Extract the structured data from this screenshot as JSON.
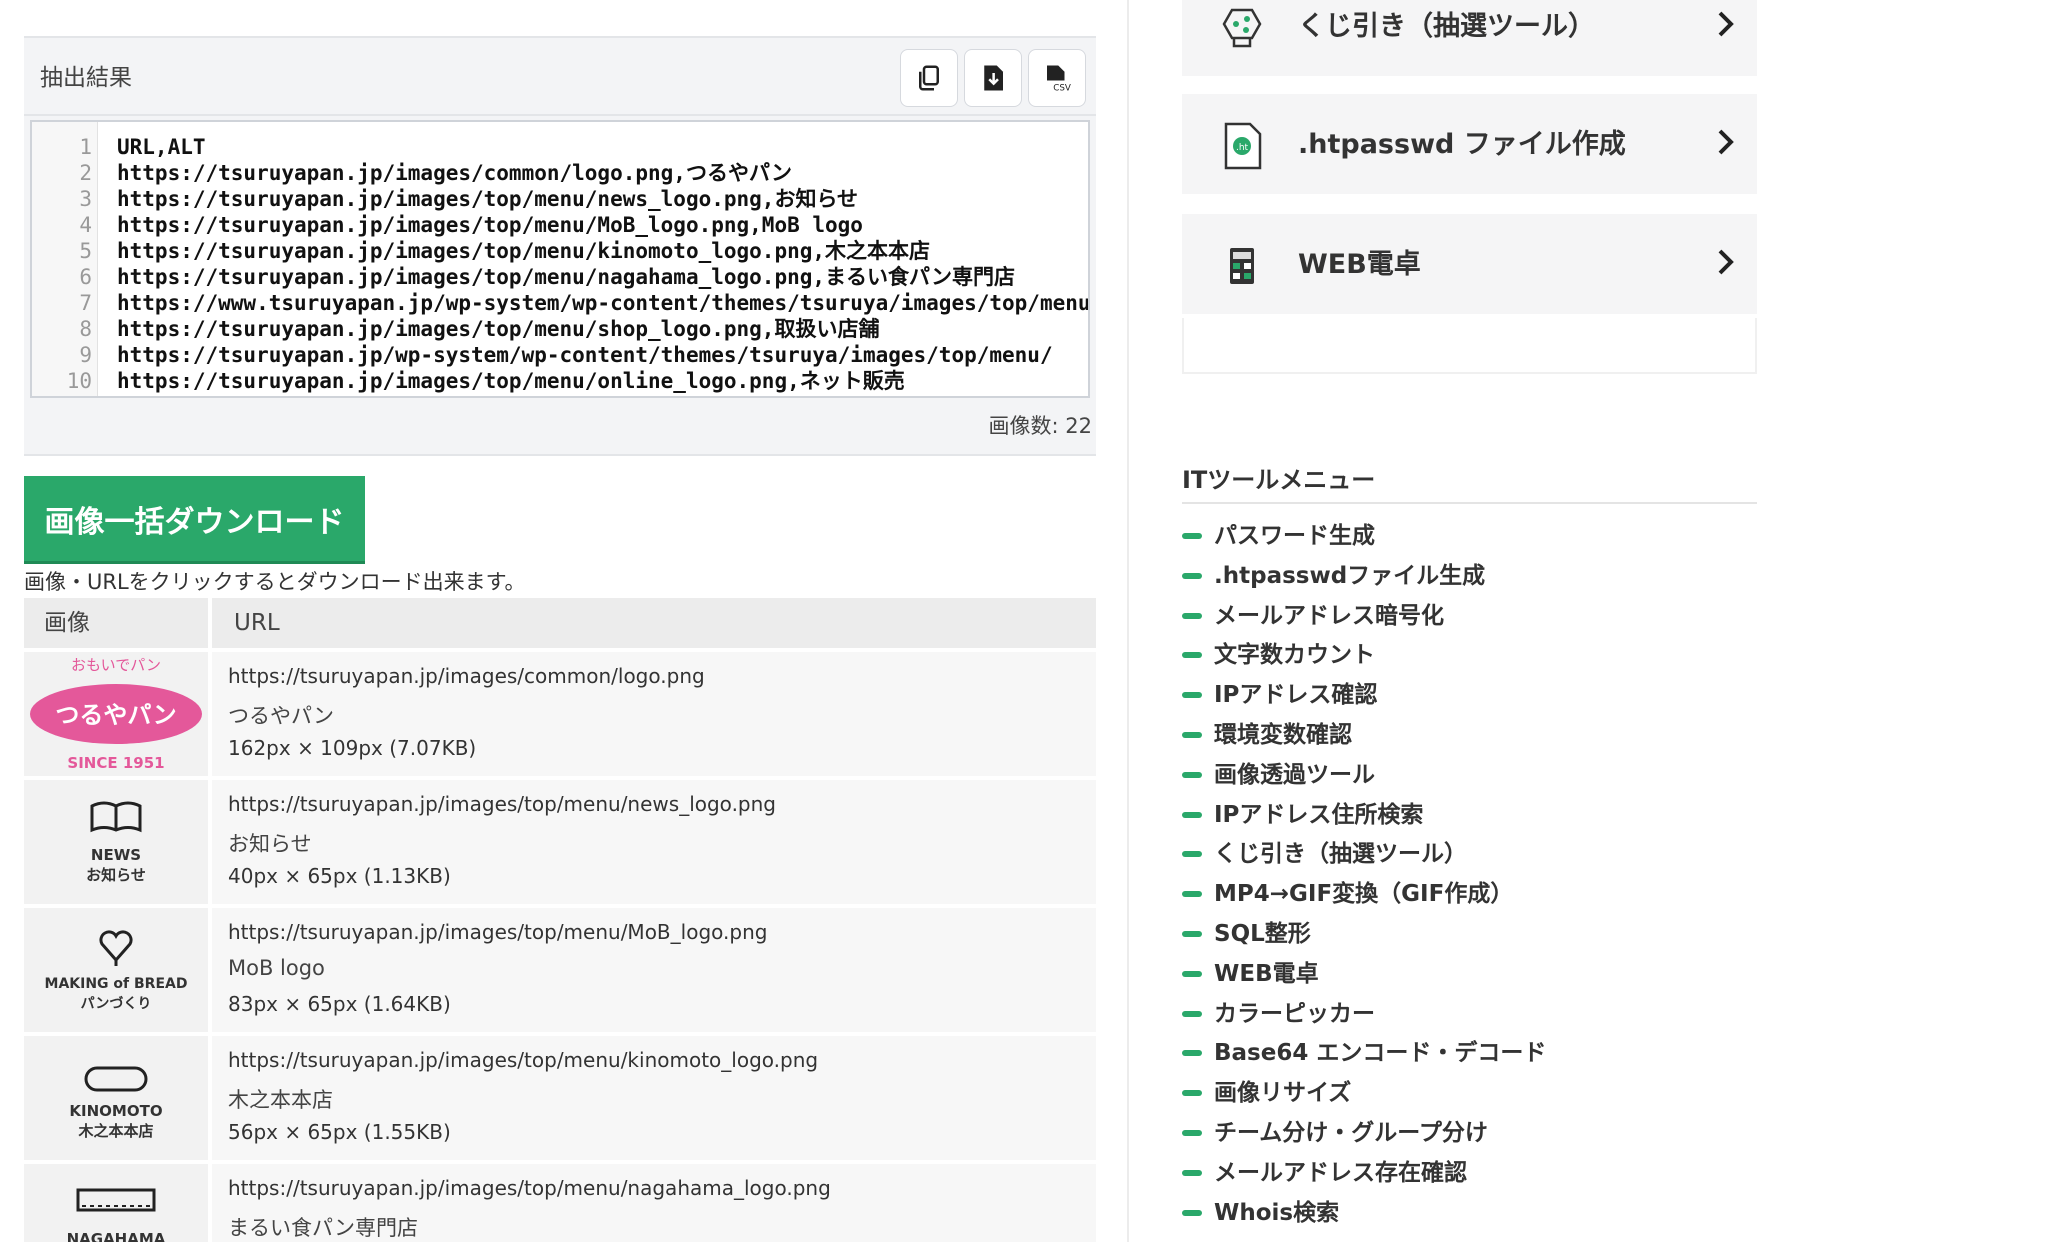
{
  "result": {
    "title": "抽出結果",
    "buttons": [
      "copy-icon",
      "download-icon",
      "csv-icon"
    ],
    "lines": [
      "URL,ALT",
      "https://tsuruyapan.jp/images/common/logo.png,つるやパン",
      "https://tsuruyapan.jp/images/top/menu/news_logo.png,お知らせ",
      "https://tsuruyapan.jp/images/top/menu/MoB_logo.png,MoB logo",
      "https://tsuruyapan.jp/images/top/menu/kinomoto_logo.png,木之本本店",
      "https://tsuruyapan.jp/images/top/menu/nagahama_logo.png,まるい食パン専門店",
      "https://www.tsuruyapan.jp/wp-system/wp-content/themes/tsuruya/images/top/menu/",
      "https://tsuruyapan.jp/images/top/menu/shop_logo.png,取扱い店舗",
      "https://tsuruyapan.jp/wp-system/wp-content/themes/tsuruya/images/top/menu/",
      "https://tsuruyapan.jp/images/top/menu/online_logo.png,ネット販売"
    ],
    "count_label": "画像数: 22"
  },
  "download_button": "画像一括ダウンロード",
  "hint": "画像・URLをクリックするとダウンロード出来ます。",
  "table": {
    "col_image": "画像",
    "col_url": "URL",
    "rows": [
      {
        "url": "https://tsuruyapan.jp/images/common/logo.png",
        "alt": "つるやパン",
        "size": "162px × 109px (7.07KB)",
        "logo_top": "おもいでパン",
        "logo_main": "つるやパン",
        "logo_bottom": "SINCE 1951"
      },
      {
        "url": "https://tsuruyapan.jp/images/top/menu/news_logo.png",
        "alt": "お知らせ",
        "size": "40px × 65px (1.13KB)",
        "logo_en": "NEWS",
        "logo_jp": "お知らせ"
      },
      {
        "url": "https://tsuruyapan.jp/images/top/menu/MoB_logo.png",
        "alt": "MoB logo",
        "size": "83px × 65px (1.64KB)",
        "logo_en": "MAKING of BREAD",
        "logo_jp": "パンづくり"
      },
      {
        "url": "https://tsuruyapan.jp/images/top/menu/kinomoto_logo.png",
        "alt": "木之本本店",
        "size": "56px × 65px (1.55KB)",
        "logo_en": "KINOMOTO",
        "logo_jp": "木之本本店"
      },
      {
        "url": "https://tsuruyapan.jp/images/top/menu/nagahama_logo.png",
        "alt": "まるい食パン専門店",
        "size": "",
        "logo_en": "NAGAHAMA",
        "logo_jp": ""
      }
    ]
  },
  "tool_cards": [
    {
      "label": "くじ引き（抽選ツール）",
      "icon": "lottery-icon"
    },
    {
      "label": ".htpasswd ファイル作成",
      "icon": "file-icon"
    },
    {
      "label": "WEB電卓",
      "icon": "calculator-icon"
    }
  ],
  "menu": {
    "title": "ITツールメニュー",
    "items": [
      "パスワード生成",
      ".htpasswdファイル生成",
      "メールアドレス暗号化",
      "文字数カウント",
      "IPアドレス確認",
      "環境変数確認",
      "画像透過ツール",
      "IPアドレス住所検索",
      "くじ引き（抽選ツール）",
      "MP4→GIF変換（GIF作成）",
      "SQL整形",
      "WEB電卓",
      "カラーピッカー",
      "Base64 エンコード・デコード",
      "画像リサイズ",
      "チーム分け・グループ分け",
      "メールアドレス存在確認",
      "Whois検索"
    ]
  },
  "colors": {
    "accent": "#2aa86a",
    "logo_pink": "#e4589a"
  }
}
